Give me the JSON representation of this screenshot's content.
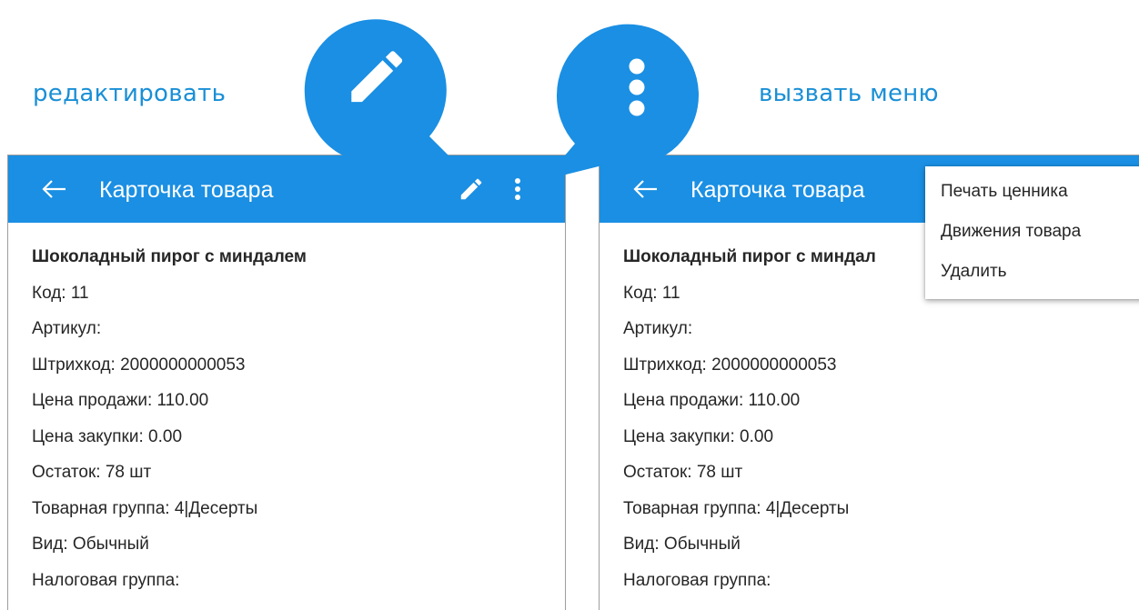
{
  "callouts": {
    "edit_label": "редактировать",
    "menu_label": "вызвать меню"
  },
  "colors": {
    "accent": "#1a8fe3",
    "callout_text": "#1a8fd6"
  },
  "icons": {
    "back": "arrow-back-icon",
    "edit": "pencil-icon",
    "more": "more-vert-icon"
  },
  "left_screen": {
    "title": "Карточка товара",
    "product": {
      "name": "Шоколадный пирог с миндалем",
      "code": "Код: 11",
      "article": "Артикул:",
      "barcode": "Штрихкод: 2000000000053",
      "sale_price": "Цена продажи: 110.00",
      "purchase_price": "Цена закупки: 0.00",
      "stock": "Остаток: 78 шт",
      "group": "Товарная группа: 4|Десерты",
      "kind": "Вид: Обычный",
      "tax_group": "Налоговая группа:"
    }
  },
  "right_screen": {
    "title": "Карточка товара",
    "product": {
      "name": "Шоколадный пирог с миндал",
      "code": "Код: 11",
      "article": "Артикул:",
      "barcode": "Штрихкод: 2000000000053",
      "sale_price": "Цена продажи: 110.00",
      "purchase_price": "Цена закупки: 0.00",
      "stock": "Остаток: 78 шт",
      "group": "Товарная группа: 4|Десерты",
      "kind": "Вид: Обычный",
      "tax_group": "Налоговая группа:"
    },
    "menu": {
      "items": [
        "Печать ценника",
        "Движения товара",
        "Удалить"
      ]
    }
  }
}
